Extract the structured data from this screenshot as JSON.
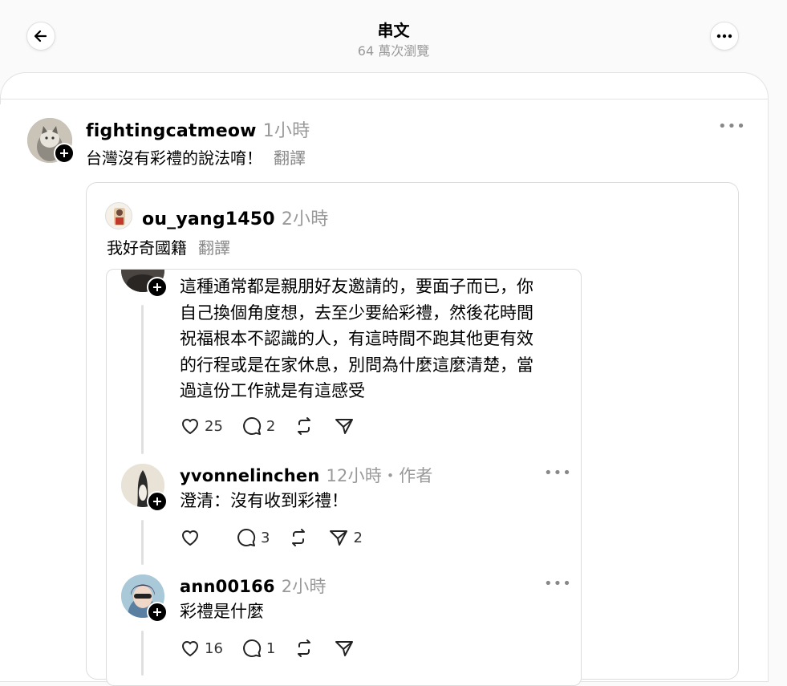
{
  "header": {
    "title": "串文",
    "views": "64 萬次瀏覽"
  },
  "main_post": {
    "username": "fightingcatmeow",
    "time": "1小時",
    "text": "台灣沒有彩禮的說法唷！",
    "translate": "翻譯"
  },
  "quoted_post": {
    "username": "ou_yang1450",
    "time": "2小時",
    "text": "我好奇國籍",
    "translate": "翻譯"
  },
  "nested": {
    "body_lines": [
      "這種通常都是親朋好友邀請的，要面子而已，你",
      "自己換個角度想，去至少要給彩禮，然後花時間",
      "祝福根本不認識的人，有這時間不跑其他更有效",
      "的行程或是在家休息，別問為什麼這麼清楚，當",
      "過這份工作就是有這感受"
    ],
    "likes": "25",
    "comments": "2",
    "reply1": {
      "username": "yvonnelinchen",
      "meta": "12小時・作者",
      "text": "澄清：沒有收到彩禮！",
      "comments": "3",
      "shares": "2"
    },
    "reply2": {
      "username": "ann00166",
      "time": "2小時",
      "text": "彩禮是什麼",
      "likes": "16",
      "comments": "1"
    }
  }
}
